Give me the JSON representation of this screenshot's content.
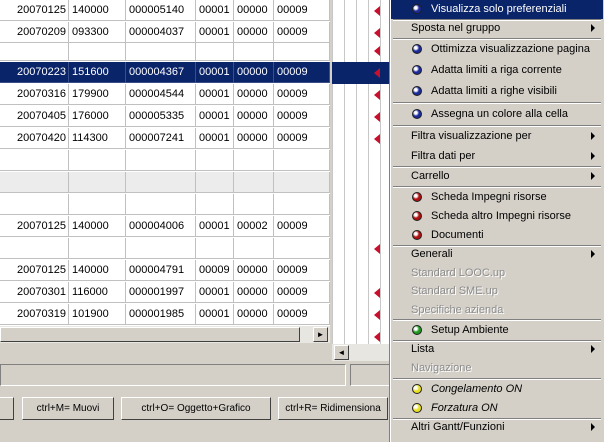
{
  "grid": {
    "rows": [
      [
        "20070125",
        "140000",
        "000005140",
        "00001",
        "00000",
        "00009"
      ],
      [
        "20070209",
        "093300",
        "000004037",
        "00001",
        "00000",
        "00009"
      ],
      [
        "20070223",
        "151600",
        "000004367",
        "00001",
        "00000",
        "00009"
      ],
      [
        "20070316",
        "179900",
        "000004544",
        "00001",
        "00000",
        "00009"
      ],
      [
        "20070405",
        "176000",
        "000005335",
        "00001",
        "00000",
        "00009"
      ],
      [
        "20070420",
        "114300",
        "000007241",
        "00001",
        "00000",
        "00009"
      ],
      [
        "",
        "",
        "",
        "",
        "",
        ""
      ],
      [
        "",
        "",
        "",
        "",
        "",
        ""
      ],
      [
        "",
        "",
        "",
        "",
        "",
        ""
      ],
      [
        "",
        "",
        "",
        "",
        "",
        ""
      ],
      [
        "20070125",
        "140000",
        "000004006",
        "00001",
        "00002",
        "00009"
      ],
      [
        "",
        "",
        "",
        "",
        "",
        ""
      ],
      [
        "20070125",
        "140000",
        "000004791",
        "00009",
        "00000",
        "00009"
      ],
      [
        "20070301",
        "116000",
        "000001997",
        "00001",
        "00000",
        "00009"
      ],
      [
        "20070319",
        "101900",
        "000001985",
        "00001",
        "00000",
        "00009"
      ]
    ]
  },
  "gantt": {
    "markers": [
      true,
      true,
      true,
      true,
      true,
      true,
      false,
      false,
      false,
      false,
      true,
      false,
      true,
      true,
      true,
      true
    ]
  },
  "buttons": {
    "move": "ctrl+M= Muovi",
    "object": "ctrl+O= Oggetto+Grafico",
    "resize": "ctrl+R= Ridimensiona"
  },
  "menu": {
    "items": [
      {
        "label": "Visualizza solo preferenziali",
        "icon": "blue-dot",
        "color": "#1a2a9a",
        "highlight": true
      },
      {
        "label": "Sposta nel gruppo",
        "submenu": true
      },
      {
        "label": "Ottimizza visualizzazione pagina",
        "icon": "blue-dot",
        "color": "#1a2a9a"
      },
      {
        "label": "Adatta limiti a riga corrente",
        "icon": "blue-dot",
        "color": "#1a2a9a"
      },
      {
        "label": "Adatta limiti a righe visibili",
        "icon": "blue-dot",
        "color": "#1a2a9a"
      },
      {
        "label": "Assegna un colore alla cella",
        "icon": "blue-dot",
        "color": "#1a2a9a"
      },
      {
        "label": "Filtra visualizzazione per",
        "submenu": true
      },
      {
        "label": "Filtra dati per",
        "submenu": true
      },
      {
        "label": "Carrello",
        "submenu": true
      },
      {
        "label": "Scheda Impegni risorse",
        "icon": "red-dot",
        "color": "#b01010"
      },
      {
        "label": "Scheda altro Impegni risorse",
        "icon": "red-dot",
        "color": "#b01010"
      },
      {
        "label": "Documenti",
        "icon": "red-dot",
        "color": "#b01010"
      },
      {
        "label": "Generali",
        "submenu": true
      },
      {
        "label": "Standard LOOC.up",
        "disabled": true
      },
      {
        "label": "Standard SME.up",
        "disabled": true
      },
      {
        "label": "Specifiche azienda",
        "disabled": true
      },
      {
        "label": "Setup Ambiente",
        "icon": "green-dot",
        "color": "#1e9a1e"
      },
      {
        "label": "Lista",
        "submenu": true
      },
      {
        "label": "Navigazione",
        "disabled": true
      },
      {
        "label": "Congelamento ON",
        "icon": "yellow-dot",
        "color": "#e8e020",
        "italic": true
      },
      {
        "label": "Forzatura ON",
        "icon": "yellow-dot",
        "color": "#e8e020",
        "italic": true
      },
      {
        "label": "Altri Gantt/Funzioni",
        "submenu": true
      }
    ]
  }
}
